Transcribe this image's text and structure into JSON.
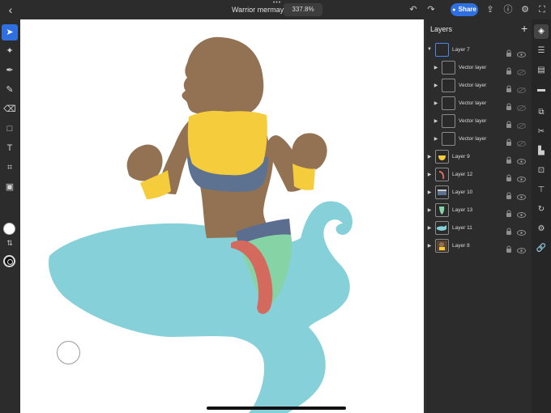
{
  "document": {
    "title": "Warrior mermay",
    "zoom": "337.8%"
  },
  "toolbar": {
    "share_label": "Share"
  },
  "layers_panel": {
    "title": "Layers",
    "layers": [
      {
        "name": "Layer 7",
        "caret": "expanded",
        "indent": 0,
        "selected": true,
        "thumb": "empty"
      },
      {
        "name": "Vector layer",
        "caret": "collapsed",
        "indent": 1,
        "thumb": "empty"
      },
      {
        "name": "Vector layer",
        "caret": "collapsed",
        "indent": 1,
        "thumb": "empty"
      },
      {
        "name": "Vector layer",
        "caret": "collapsed",
        "indent": 1,
        "thumb": "empty"
      },
      {
        "name": "Vector layer",
        "caret": "collapsed",
        "indent": 1,
        "thumb": "empty"
      },
      {
        "name": "Vector layer",
        "caret": "collapsed",
        "indent": 1,
        "thumb": "empty"
      },
      {
        "name": "Layer 9",
        "caret": "collapsed",
        "indent": 0,
        "thumb": "yellow"
      },
      {
        "name": "Layer 12",
        "caret": "collapsed",
        "indent": 0,
        "thumb": "red-stroke"
      },
      {
        "name": "Layer 10",
        "caret": "collapsed",
        "indent": 0,
        "thumb": "blue"
      },
      {
        "name": "Layer 13",
        "caret": "collapsed",
        "indent": 0,
        "thumb": "green"
      },
      {
        "name": "Layer 11",
        "caret": "collapsed",
        "indent": 0,
        "thumb": "cyan"
      },
      {
        "name": "Layer 8",
        "caret": "collapsed",
        "indent": 0,
        "thumb": "brown"
      }
    ]
  },
  "colors": {
    "accent": "#2f6fe0",
    "skin": "#937253",
    "top": "#f5cd3c",
    "band": "#5d7190",
    "tail": "#86d0d9",
    "scale_green": "#86d4a6",
    "scale_red": "#d46a5e",
    "belt": "#5b6e8f"
  }
}
